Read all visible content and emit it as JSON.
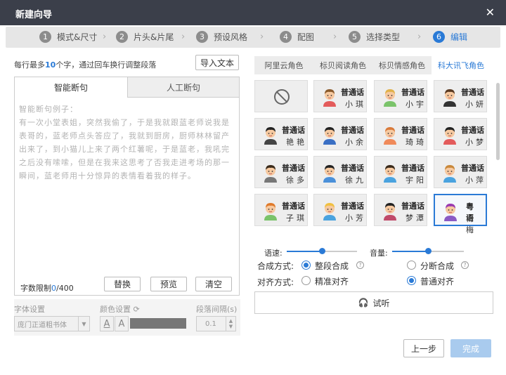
{
  "window": {
    "title": "新建向导",
    "close_icon": "✕"
  },
  "steps": [
    {
      "num": "1",
      "label": "模式&尺寸"
    },
    {
      "num": "2",
      "label": "片头&片尾"
    },
    {
      "num": "3",
      "label": "预设风格"
    },
    {
      "num": "4",
      "label": "配图"
    },
    {
      "num": "5",
      "label": "选择类型"
    },
    {
      "num": "6",
      "label": "编辑"
    }
  ],
  "active_step": 6,
  "hint": {
    "prefix": "每行最多",
    "count": "10",
    "suffix": "个字，通过回车换行调整段落"
  },
  "import_button": "导入文本",
  "editor": {
    "tabs": [
      "智能断句",
      "人工断句"
    ],
    "text": "智能断句例子：\n有一次小堂表姐，突然我偷了，于是我就跟蓝老师说我是表哥的，蓝老师点头答应了，我就到厨房，厨师林林留产出来了，到小猫儿上来了两个红薯呢，于是蓝老，我吼完之后没有嗦嗦，但是在我来这思考了否我走进考场的那一瞬间，蓝老师用十分惊异的表情看着我的样子。",
    "limit_label": "字数限制",
    "limit_current": "0",
    "limit_max": "/400",
    "buttons": {
      "replace": "替换",
      "preview": "预览",
      "clear": "清空"
    }
  },
  "font_settings": {
    "font_label": "字体设置",
    "font_value": "庞门正道粗书体",
    "color_label": "颜色设置",
    "color_swatch": "#777777",
    "spacing_label": "段落间隔(s)",
    "spacing_value": "0.1"
  },
  "voice_tabs": [
    "阿里云角色",
    "标贝阅读角色",
    "标贝情感角色",
    "科大讯飞角色"
  ],
  "active_voice_tab": 3,
  "voices": [
    {
      "type": "none"
    },
    {
      "l1": "普通话",
      "l2": "小琪",
      "hair": "#8a5a2b",
      "skin": "#f6c9a0",
      "shirt": "#e35b5b"
    },
    {
      "l1": "普通话",
      "l2": "小宇",
      "hair": "#e0b14a",
      "skin": "#f6c9a0",
      "shirt": "#7ac36a"
    },
    {
      "l1": "普通话",
      "l2": "小妍",
      "hair": "#5a3a22",
      "skin": "#f6c9a0",
      "shirt": "#333333"
    },
    {
      "l1": "普通话",
      "l2": "艳艳",
      "hair": "#222222",
      "skin": "#f6c9a0",
      "shirt": "#444444"
    },
    {
      "l1": "普通话",
      "l2": "小余",
      "hair": "#222222",
      "skin": "#f6c9a0",
      "shirt": "#3a6fc4"
    },
    {
      "l1": "普通话",
      "l2": "琦琦",
      "hair": "#d97a3a",
      "skin": "#f6c9a0",
      "shirt": "#f08a5a"
    },
    {
      "l1": "普通话",
      "l2": "小梦",
      "hair": "#222222",
      "skin": "#f6c9a0",
      "shirt": "#e35b5b"
    },
    {
      "l1": "普通话",
      "l2": "徐多",
      "hair": "#3a2a1a",
      "skin": "#f6c9a0",
      "shirt": "#777777"
    },
    {
      "l1": "普通话",
      "l2": "徐九",
      "hair": "#222222",
      "skin": "#f6c9a0",
      "shirt": "#4a90d9"
    },
    {
      "l1": "普通话",
      "l2": "宇阳",
      "hair": "#3a2a1a",
      "skin": "#f6c9a0",
      "shirt": "#4aa3df"
    },
    {
      "l1": "普通话",
      "l2": "小萍",
      "hair": "#c9883a",
      "skin": "#f6c9a0",
      "shirt": "#4aa3df"
    },
    {
      "l1": "普通话",
      "l2": "子琪",
      "hair": "#e07a2a",
      "skin": "#f6c9a0",
      "shirt": "#7ac36a"
    },
    {
      "l1": "普通话",
      "l2": "小芳",
      "hair": "#f0c040",
      "skin": "#f6c9a0",
      "shirt": "#4aa3df"
    },
    {
      "l1": "普通话",
      "l2": "梦潭",
      "hair": "#222222",
      "skin": "#f6c9a0",
      "shirt": "#c04a6a"
    },
    {
      "l1": "粤语",
      "l2": "梅梅",
      "hair": "#9a3ab0",
      "skin": "#f6c9a0",
      "shirt": "#8a5ac4",
      "selected": true
    }
  ],
  "speed_label": "语速:",
  "speed_level": 0.5,
  "volume_label": "音量:",
  "volume_level": 0.5,
  "synthesis": {
    "label": "合成方式:",
    "options": [
      "整段合成",
      "分断合成"
    ],
    "selected": 0
  },
  "alignment": {
    "label": "对齐方式:",
    "options": [
      "精准对齐",
      "普通对齐"
    ],
    "selected": 1
  },
  "listen_label": "试听",
  "footer": {
    "prev": "上一步",
    "done": "完成"
  }
}
